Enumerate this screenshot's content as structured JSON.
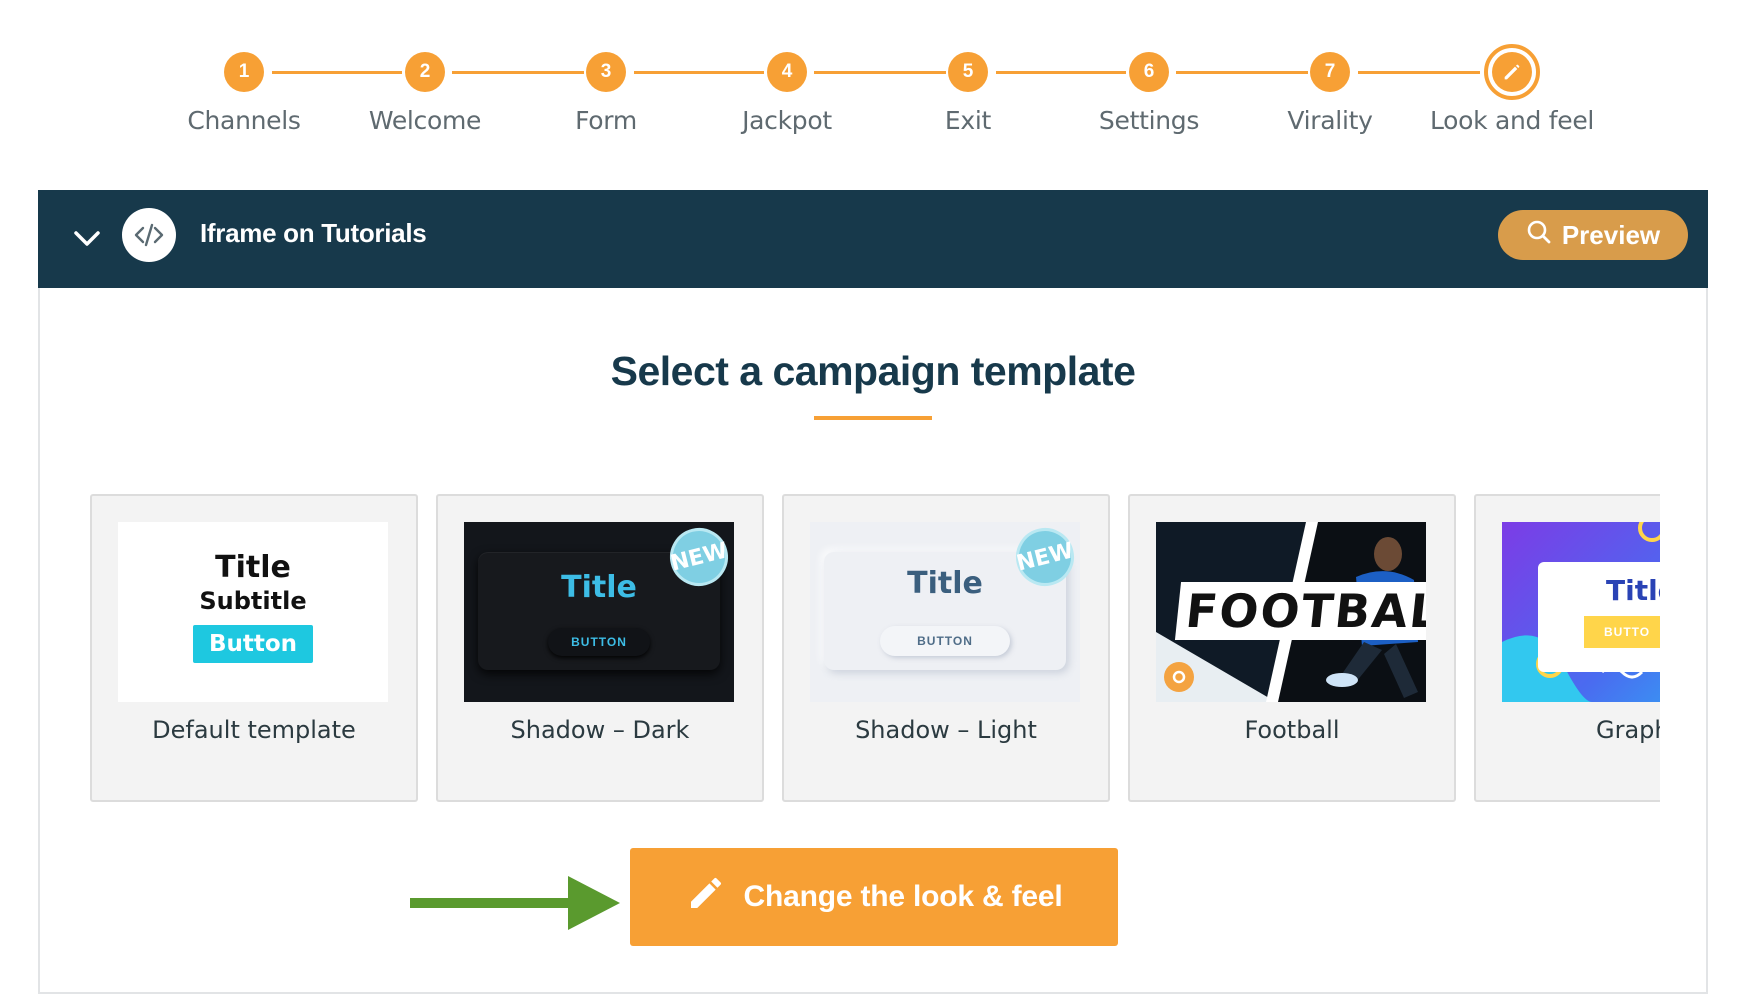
{
  "stepper": {
    "steps": [
      {
        "number": "1",
        "label": "Channels"
      },
      {
        "number": "2",
        "label": "Welcome"
      },
      {
        "number": "3",
        "label": "Form"
      },
      {
        "number": "4",
        "label": "Jackpot"
      },
      {
        "number": "5",
        "label": "Exit"
      },
      {
        "number": "6",
        "label": "Settings"
      },
      {
        "number": "7",
        "label": "Virality"
      },
      {
        "number": "",
        "label": "Look and feel",
        "icon": "pencil-icon",
        "current": true
      }
    ],
    "accent": "#f7a035"
  },
  "panel": {
    "title": "Iframe on Tutorials",
    "header_icon": "code-icon",
    "collapse_icon": "chevron-down-icon",
    "preview_label": "Preview",
    "preview_icon": "search-icon",
    "header_color": "#17394b"
  },
  "section_title": "Select a campaign template",
  "templates": [
    {
      "label": "Default template",
      "thumb": {
        "title": "Title",
        "subtitle": "Subtitle",
        "button": "Button"
      }
    },
    {
      "label": "Shadow – Dark",
      "thumb": {
        "title": "Title",
        "button": "BUTTON",
        "badge": "NEW"
      }
    },
    {
      "label": "Shadow – Light",
      "thumb": {
        "title": "Title",
        "button": "BUTTON",
        "badge": "NEW"
      }
    },
    {
      "label": "Football",
      "thumb": {
        "wordmark": "FOOTBALL"
      }
    },
    {
      "label": "Graph",
      "thumb": {
        "title": "Title",
        "button": "BUTTO"
      }
    }
  ],
  "cta": {
    "label": "Change the look & feel",
    "icon": "pencil-icon",
    "arrow_color": "#5a9a2e"
  }
}
